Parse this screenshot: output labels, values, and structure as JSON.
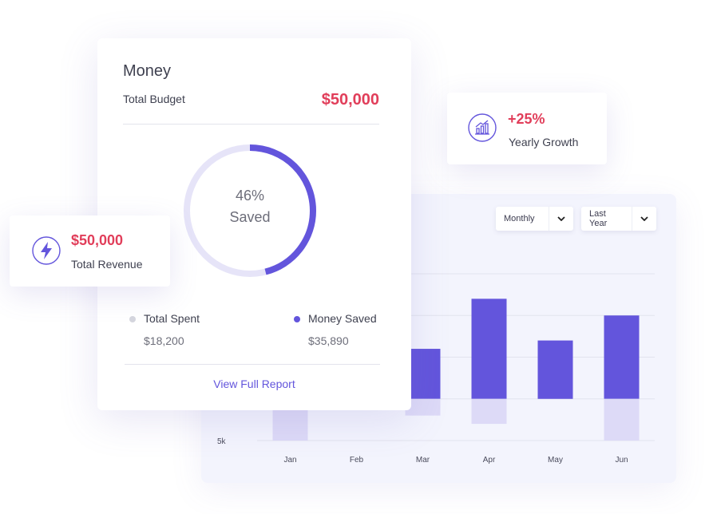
{
  "money_card": {
    "title": "Money",
    "budget_label": "Total Budget",
    "budget_value": "$50,000",
    "donut_percent": "46%",
    "donut_label": "Saved",
    "saved_fraction": 0.46,
    "spent_label": "Total Spent",
    "spent_value": "$18,200",
    "saved_label": "Money Saved",
    "saved_value": "$35,890",
    "report_link": "View Full Report"
  },
  "growth_card": {
    "value": "+25%",
    "label": "Yearly Growth",
    "icon": "bar-chart-growth-icon"
  },
  "revenue_card": {
    "value": "$50,000",
    "label": "Total Revenue",
    "icon": "lightning-bolt-icon"
  },
  "chart_controls": {
    "period": "Monthly",
    "range": "Last Year"
  },
  "colors": {
    "accent": "#6355dc",
    "accent_light": "#dddaf7",
    "track": "#e6e4f8",
    "value_red": "#e13e5a",
    "dot_gray": "#d5d6de"
  },
  "chart_data": {
    "type": "bar",
    "categories": [
      "Jan",
      "Feb",
      "Mar",
      "Apr",
      "May",
      "Jun"
    ],
    "ytick_labels": [
      "5k"
    ],
    "series": [
      {
        "values": [
          null,
          null,
          12,
          24,
          14,
          20
        ]
      },
      {
        "values": [
          -10,
          null,
          -4,
          -6,
          null,
          -10
        ]
      }
    ],
    "ylim": [
      -10,
      30
    ],
    "grid": true
  }
}
